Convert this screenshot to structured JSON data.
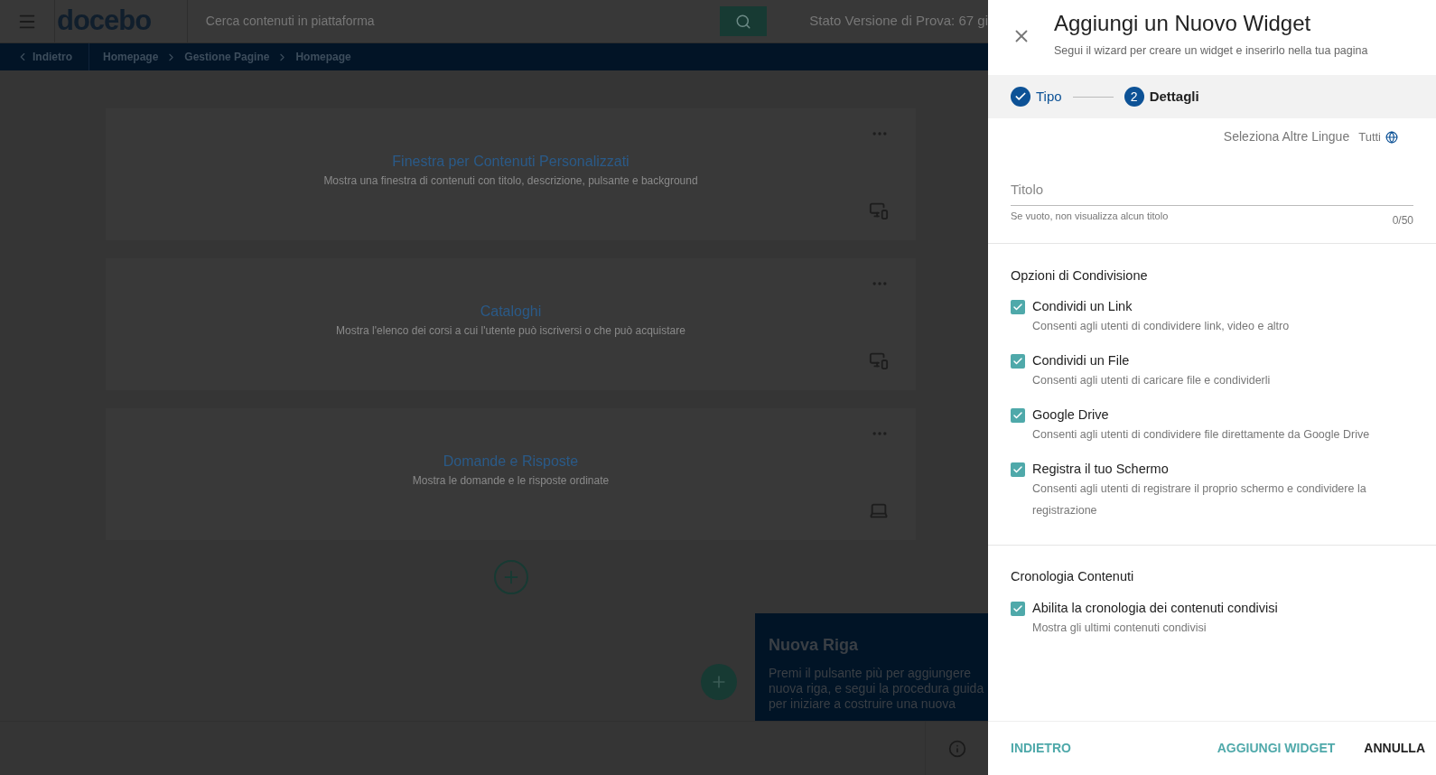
{
  "header": {
    "logo": "docebo",
    "search_placeholder": "Cerca contenuti in piattaforma",
    "trial_status": "Stato Versione di Prova: 67 gi"
  },
  "breadcrumb": {
    "back": "Indietro",
    "items": [
      "Homepage",
      "Gestione Pagine",
      "Homepage"
    ]
  },
  "widgets": [
    {
      "title": "Finestra per Contenuti Personalizzati",
      "description": "Mostra una finestra di contenuti con titolo, descrizione, pulsante e background",
      "kind": "responsive"
    },
    {
      "title": "Cataloghi",
      "description": "Mostra l'elenco dei corsi a cui l'utente può iscriversi o che può acquistare",
      "kind": "responsive"
    },
    {
      "title": "Domande e Risposte",
      "description": "Mostra le domande e le risposte ordinate",
      "kind": "desktop"
    }
  ],
  "tooltip": {
    "title": "Nuova Riga",
    "lines": [
      "Premi il pulsante più per aggiungere",
      "nuova riga, e segui la procedura guida",
      "per iniziare a costruire una nuova"
    ]
  },
  "panel": {
    "title": "Aggiungi un Nuovo Widget",
    "subtitle": "Segui il wizard per creare un widget e inserirlo nella tua pagina",
    "steps": [
      {
        "label": "Tipo",
        "done": true
      },
      {
        "label": "Dettagli",
        "number": "2",
        "done": false
      }
    ],
    "languages": {
      "label": "Seleziona Altre Lingue",
      "value": "Tutti"
    },
    "title_field": {
      "placeholder": "Titolo",
      "hint": "Se vuoto, non visualizza alcun titolo",
      "counter": "0/50"
    },
    "sections": [
      {
        "heading": "Opzioni di Condivisione",
        "options": [
          {
            "label": "Condividi un Link",
            "description": "Consenti agli utenti di condividere link, video e altro",
            "checked": true
          },
          {
            "label": "Condividi un File",
            "description": "Consenti agli utenti di caricare file e condividerli",
            "checked": true
          },
          {
            "label": "Google Drive",
            "description": "Consenti agli utenti di condividere file direttamente da Google Drive",
            "checked": true
          },
          {
            "label": "Registra il tuo Schermo",
            "description": "Consenti agli utenti di registrare il proprio schermo e condividere la registrazione",
            "checked": true
          }
        ]
      },
      {
        "heading": "Cronologia Contenuti",
        "options": [
          {
            "label": "Abilita la cronologia dei contenuti condivisi",
            "description": "Mostra gli ultimi contenuti condivisi",
            "checked": true
          }
        ]
      }
    ],
    "footer": {
      "back": "INDIETRO",
      "add": "AGGIUNGI WIDGET",
      "cancel": "ANNULLA"
    }
  }
}
